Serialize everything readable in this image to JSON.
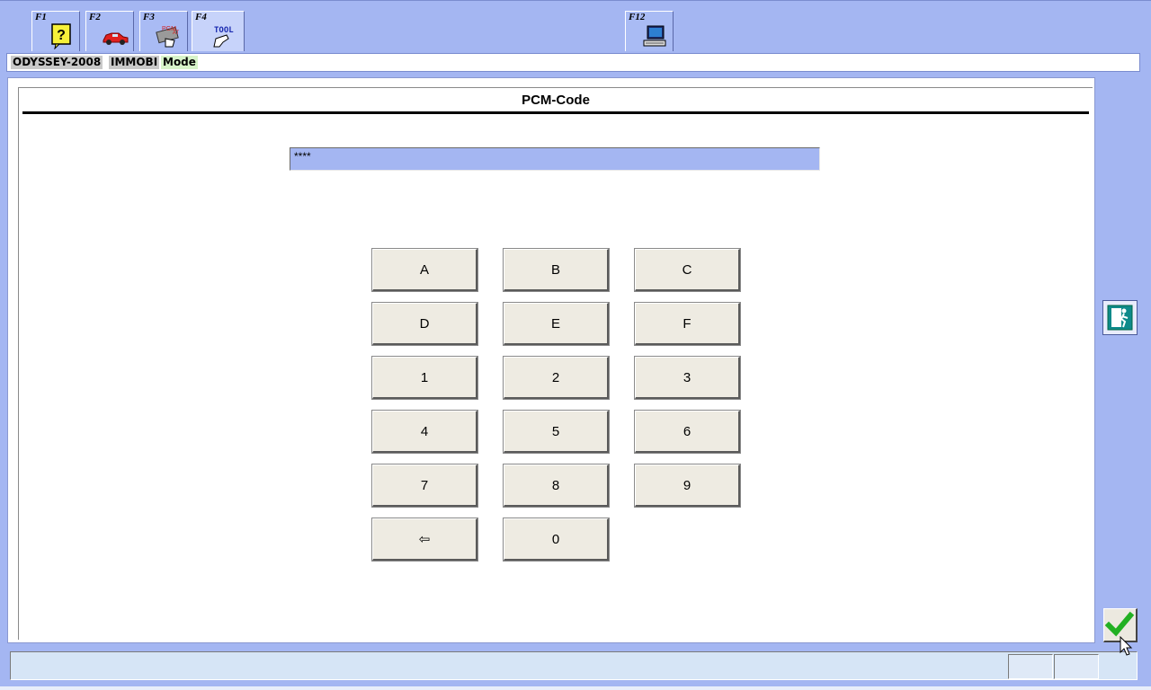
{
  "toolbar": {
    "keys": [
      {
        "label": "F1",
        "icon": "help-icon"
      },
      {
        "label": "F2",
        "icon": "car-icon"
      },
      {
        "label": "F3",
        "icon": "ecu-icon"
      },
      {
        "label": "F4",
        "icon": "tool-icon",
        "text": "TOOL"
      },
      {
        "label": "F12",
        "icon": "computer-icon"
      }
    ]
  },
  "breadcrumb": {
    "items": [
      "ODYSSEY-2008",
      "IMMOBI",
      "Mode"
    ]
  },
  "panel": {
    "title": "PCM-Code",
    "code_value": "****"
  },
  "keypad": {
    "rows": [
      [
        "A",
        "B",
        "C"
      ],
      [
        "D",
        "E",
        "F"
      ],
      [
        "1",
        "2",
        "3"
      ],
      [
        "4",
        "5",
        "6"
      ],
      [
        "7",
        "8",
        "9"
      ],
      [
        "⇦",
        "0"
      ]
    ]
  },
  "colors": {
    "background": "#a4b6f2",
    "field": "#a4b6f2",
    "key": "#eeebe2",
    "ok_check": "#22b022",
    "exit_icon": "#0e8a8a"
  }
}
